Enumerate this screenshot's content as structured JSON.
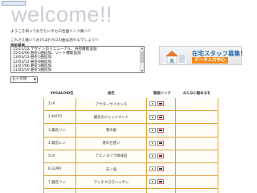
{
  "header": {
    "title": "welcome!!"
  },
  "intro": {
    "line1": "ようこそ知っておきたいボカロ名曲リンク集へ!!",
    "line2": "これさえ聴いておけばボカロの曲は語れるでしょう!!"
  },
  "updates": {
    "label": "更新履歴",
    "items": [
      "15/11/22 デザインのリニューアル、共有機能追加",
      "15/10/06 曲を1曲追加、ソート機能追加",
      "13/03/13 曲を1曲追加",
      "12/03/12 曲を6曲追加",
      "11/07/06 曲を5曲追加",
      "11/05/10 曲を5曲追加"
    ]
  },
  "banner": {
    "text1": "在宅スタッフ募集!",
    "text2": "データ入力中心"
  },
  "sort": {
    "selected": "五十音順"
  },
  "table": {
    "headers": {
      "name": "VOCALOID名",
      "title": "曲名",
      "links": "動画リンク",
      "tag": "みんなに勧めるを"
    },
    "rows": [
      {
        "name": "1.IA",
        "title": "アウターサイエンス"
      },
      {
        "name": "2.KAITO",
        "title": "鏡音のジャッジメント"
      },
      {
        "name": "3.鏡音リン",
        "title": "悪の娘"
      },
      {
        "name": "4.鏡音レン",
        "title": "悪の召使い"
      },
      {
        "name": "5.IA",
        "title": "アスノヨゾラ哨戒班"
      },
      {
        "name": "6.GUMI",
        "title": "天ノ弱"
      },
      {
        "name": "7.鏡音リン",
        "title": "アンチクロロハッサン"
      },
      {
        "name": "8.初音ミク",
        "title": "アンハッピーリフレイン"
      }
    ]
  },
  "icons": {
    "video": "video-link-icon",
    "niconico": "niconico-link-icon"
  },
  "colors": {
    "title": "#c9ced4",
    "table_border": "#e0a33a",
    "banner_accent": "#f28c1e",
    "banner_text": "#2a6fb0"
  }
}
